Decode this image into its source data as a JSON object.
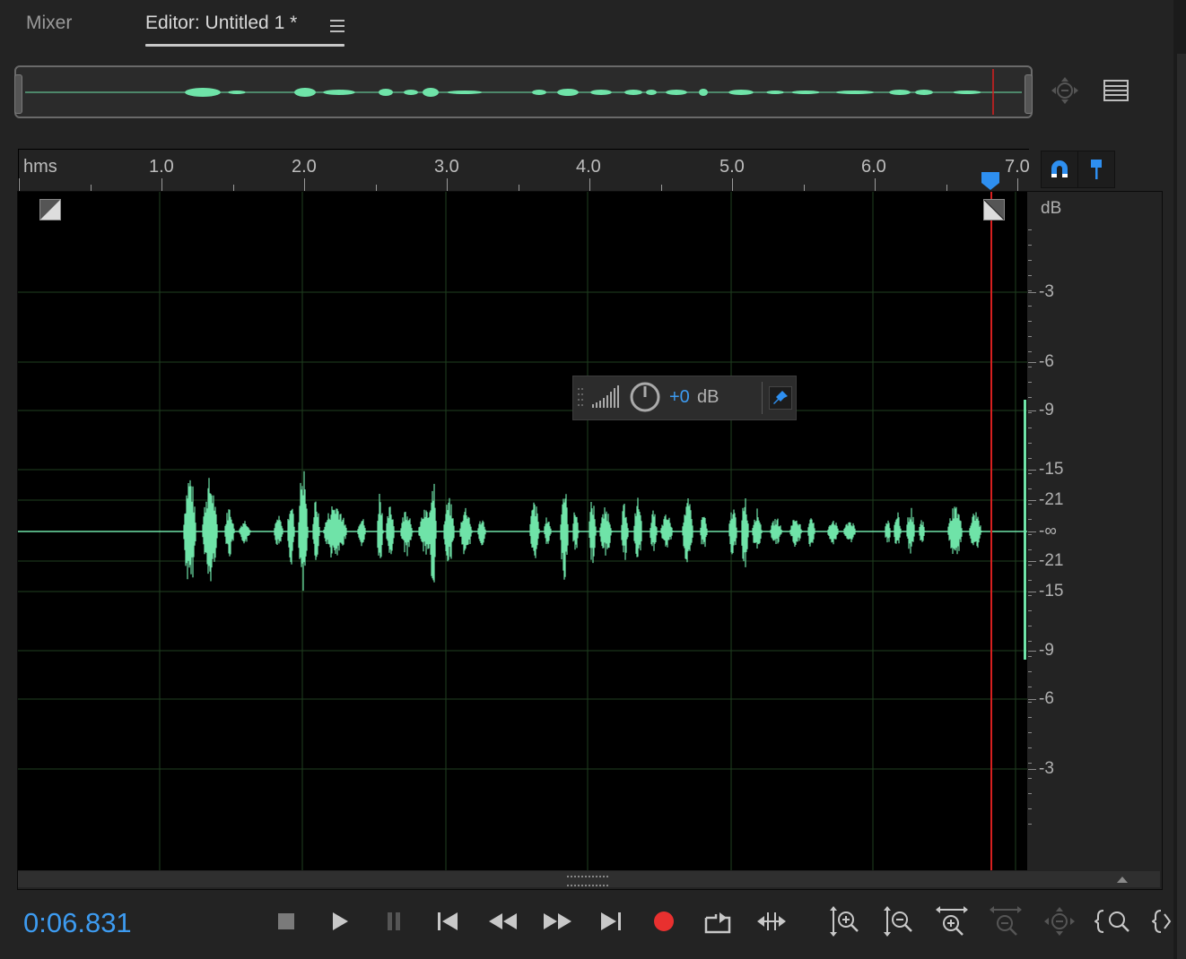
{
  "tabs": [
    {
      "label": "Mixer"
    },
    {
      "label": "Editor: Untitled 1 *"
    }
  ],
  "ruler": {
    "unit_label": "hms",
    "ticks": [
      "1.0",
      "2.0",
      "3.0",
      "4.0",
      "5.0",
      "6.0",
      "7.0"
    ]
  },
  "amplitude_scale": {
    "unit": "dB",
    "labels": [
      "-3",
      "-6",
      "-9",
      "-15",
      "-21",
      "-∞",
      "-21",
      "-15",
      "-9",
      "-6",
      "-3"
    ]
  },
  "hud": {
    "gain_value": "+0",
    "gain_unit": "dB"
  },
  "transport": {
    "timecode": "0:06.831"
  },
  "playhead": {
    "time_seconds": 6.831
  },
  "colors": {
    "waveform": "#6fe3a8",
    "playhead": "#d81f1f",
    "timecode": "#3d9bf0",
    "record": "#e8302f",
    "accent_blue": "#2e8ff0"
  },
  "icons": {
    "overview_zoom": "zoom-selection-icon",
    "overview_menu": "panel-menu-icon",
    "snap": "magnet-icon",
    "marker": "pin-icon",
    "fade_in": "fade-in-handle-icon",
    "fade_out": "fade-out-handle-icon",
    "hud_meter": "level-meter-icon",
    "hud_knob": "volume-knob-icon",
    "hud_pin": "pin-icon"
  }
}
